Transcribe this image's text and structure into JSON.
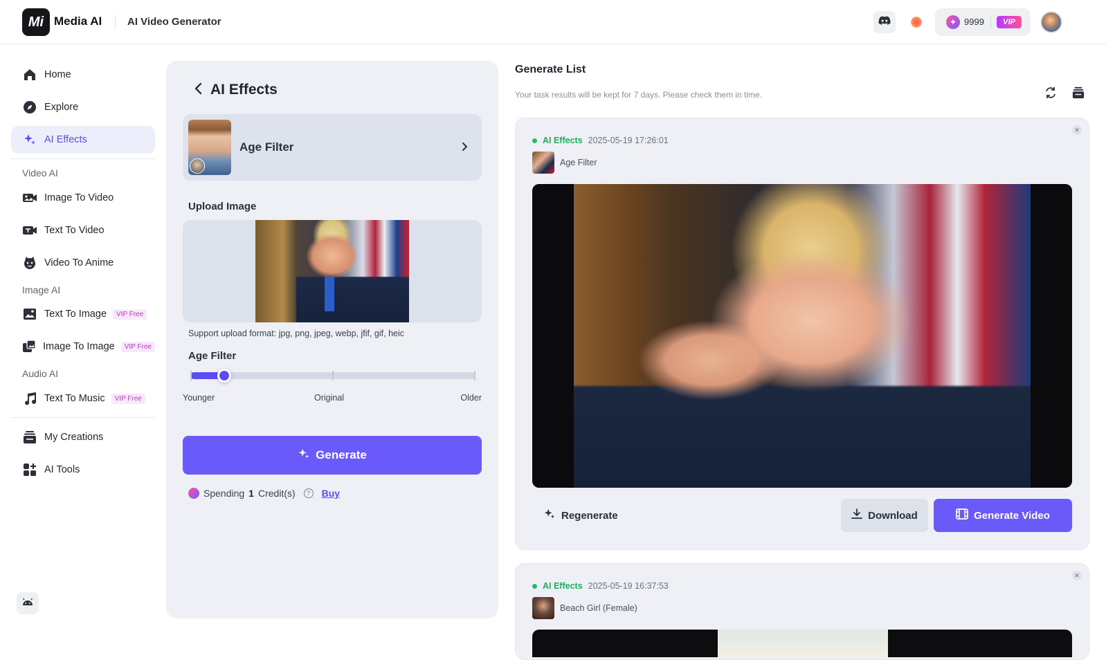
{
  "header": {
    "logo_text": "Mi",
    "brand": "Media AI",
    "app_title": "AI Video Generator",
    "credits": "9999",
    "vip_label": "VIP"
  },
  "sidebar": {
    "home": "Home",
    "explore": "Explore",
    "ai_effects": "AI Effects",
    "section_video": "Video AI",
    "image_to_video": "Image To Video",
    "text_to_video": "Text To Video",
    "video_to_anime": "Video To Anime",
    "section_image": "Image AI",
    "text_to_image": "Text To Image",
    "image_to_image": "Image To Image",
    "section_audio": "Audio AI",
    "text_to_music": "Text To Music",
    "vip_free": "VIP Free",
    "my_creations": "My Creations",
    "ai_tools": "AI Tools",
    "active_color": "#5b4cf5"
  },
  "panel": {
    "title": "AI Effects",
    "effect_name": "Age Filter",
    "upload_label": "Upload Image",
    "upload_hint": "Support upload format: jpg, png, jpeg, webp, jfif, gif, heic",
    "slider_label": "Age Filter",
    "slider_min_label": "Younger",
    "slider_mid_label": "Original",
    "slider_max_label": "Older",
    "slider_value": 0.12,
    "generate_label": "Generate",
    "spending_prefix": "Spending",
    "spending_amount": "1",
    "spending_suffix": "Credit(s)",
    "buy_label": "Buy",
    "accent_color": "#6a5af9"
  },
  "generate_list": {
    "title": "Generate List",
    "subtitle": "Your task results will be kept for 7 days. Please check them in time.",
    "tasks": [
      {
        "type": "AI Effects",
        "time": "2025-05-19 17:26:01",
        "effect": "Age Filter",
        "regenerate_label": "Regenerate",
        "download_label": "Download",
        "generate_video_label": "Generate Video"
      },
      {
        "type": "AI Effects",
        "time": "2025-05-19 16:37:53",
        "effect": "Beach Girl (Female)"
      }
    ],
    "status_color": "#1fbf6a"
  }
}
